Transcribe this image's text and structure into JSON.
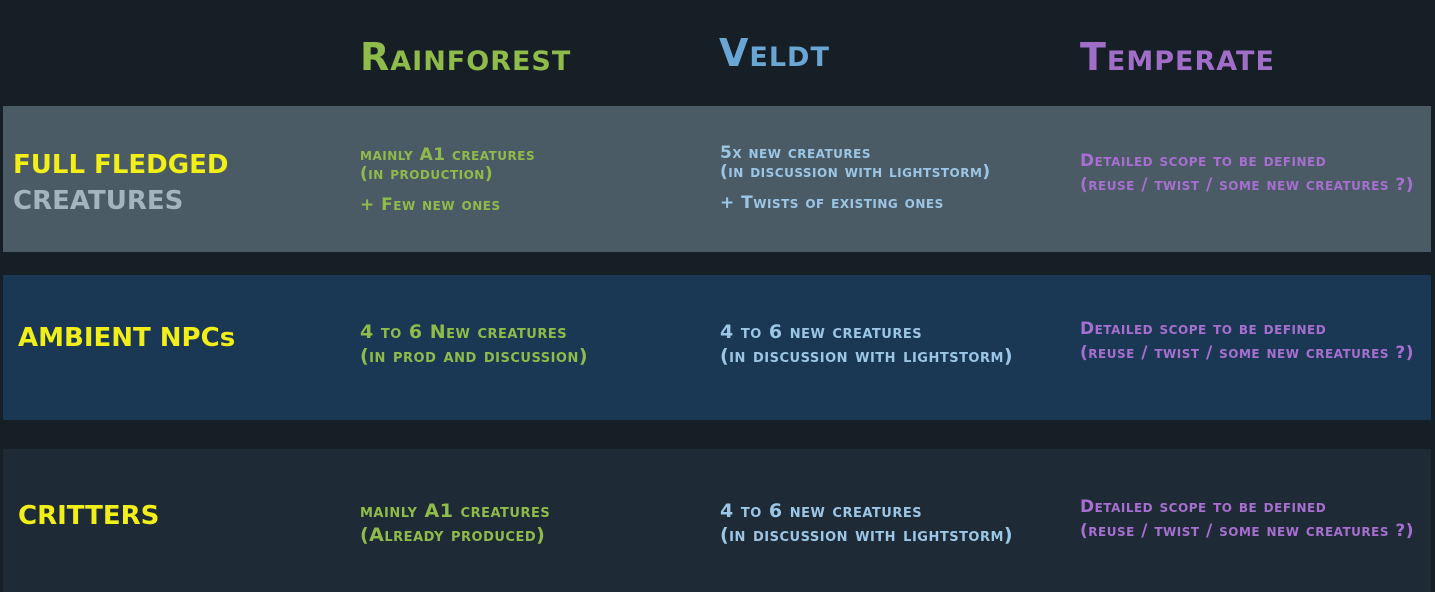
{
  "columns": {
    "rainforest": "Rainforest",
    "veldt": "Veldt",
    "temperate": "Temperate"
  },
  "rows": {
    "full_fledged": {
      "label_line1": "FULL FLEDGED",
      "label_line2": "CREATURES",
      "rainforest": {
        "line1": "mainly A1 creatures",
        "line2": "(in production)",
        "extra": "+ Few new ones"
      },
      "veldt": {
        "line1": "5x new creatures",
        "line2": "(in discussion with lightstorm)",
        "extra": "+ Twists of existing ones"
      },
      "temperate": {
        "line1": "Detailed scope to be defined",
        "line2": "(reuse / twist / some new creatures ?)"
      }
    },
    "ambient_npcs": {
      "label": "AMBIENT NPCs",
      "rainforest": {
        "line1": "4 to 6 New creatures",
        "line2": "(in prod and discussion)"
      },
      "veldt": {
        "line1": "4 to 6 new creatures",
        "line2": "(in discussion with lightstorm)"
      },
      "temperate": {
        "line1": "Detailed scope to be defined",
        "line2": "(reuse / twist / some new creatures ?)"
      }
    },
    "critters": {
      "label": "CRITTERS",
      "rainforest": {
        "line1": "mainly A1 creatures",
        "line2": "(Already produced)"
      },
      "veldt": {
        "line1": "4 to 6 new creatures",
        "line2": "(in discussion with lightstorm)"
      },
      "temperate": {
        "line1": "Detailed scope to be defined",
        "line2": "(reuse / twist / some new creatures ?)"
      }
    }
  },
  "colors": {
    "background": "#161e26",
    "band_full_fledged": "#4a5b65",
    "band_ambient": "#1a3853",
    "band_critters": "#1e2a35",
    "rainforest": "#8fbb4b",
    "veldt": "#6aa6d4",
    "temperate": "#a06ec8",
    "row_label": "#f2ee17"
  }
}
